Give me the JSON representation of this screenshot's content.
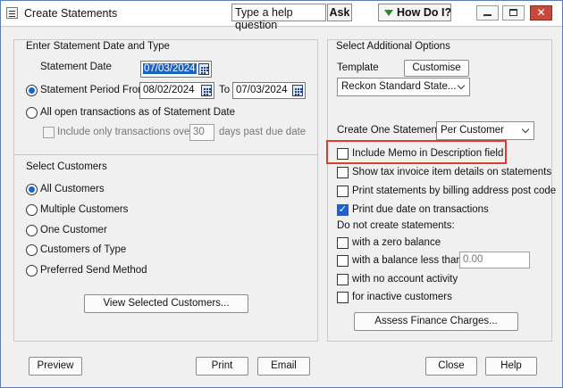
{
  "window": {
    "title": "Create Statements"
  },
  "help": {
    "question_placeholder": "Type a help question",
    "ask_label": "Ask",
    "how_do_i_label": "How Do I?"
  },
  "date_type": {
    "heading": "Enter Statement Date and Type",
    "statement_date_label": "Statement Date",
    "statement_date_value": "07/03/2024",
    "period_label": "Statement Period From",
    "period_from": "08/02/2024",
    "to_label": "To",
    "period_to": "07/03/2024",
    "all_open_label": "All open transactions as of Statement Date",
    "include_only_label": "Include only transactions over",
    "days_value": "30",
    "days_suffix": "days past due date"
  },
  "customers": {
    "heading": "Select Customers",
    "options": [
      "All Customers",
      "Multiple Customers",
      "One Customer",
      "Customers of Type",
      "Preferred Send Method"
    ],
    "view_button": "View Selected Customers..."
  },
  "options": {
    "heading": "Select Additional Options",
    "template_label": "Template",
    "customise_button": "Customise",
    "template_value": "Reckon Standard State...",
    "create_one_label": "Create One Statement",
    "create_one_value": "Per Customer",
    "include_memo": "Include Memo in Description field",
    "show_tax": "Show tax invoice item details on statements",
    "print_billing": "Print statements by billing address post code",
    "print_due": "Print due date on transactions",
    "do_not_create": "Do not create statements:",
    "zero_balance": "with a zero balance",
    "balance_less": "with a balance less than",
    "balance_value": "0.00",
    "no_activity": "with no account activity",
    "inactive": "for inactive customers",
    "assess_button": "Assess Finance Charges..."
  },
  "footer": {
    "preview": "Preview",
    "print": "Print",
    "email": "Email",
    "close": "Close",
    "help": "Help"
  }
}
